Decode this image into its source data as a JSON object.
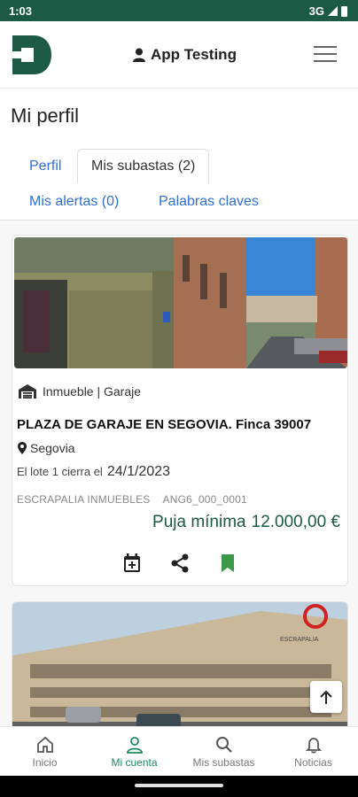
{
  "status_bar": {
    "time": "1:03",
    "network": "3G"
  },
  "header": {
    "user_label": "App Testing"
  },
  "page": {
    "title": "Mi perfil"
  },
  "tabs": [
    {
      "label": "Perfil"
    },
    {
      "label": "Mis subastas (2)"
    },
    {
      "label": "Mis alertas (0)"
    },
    {
      "label": "Palabras claves"
    }
  ],
  "listing": {
    "category": "Inmueble | Garaje",
    "title": "PLAZA DE GARAJE EN SEGOVIA. Finca 39007",
    "location": "Segovia",
    "close_prefix": "El lote 1  cierra el",
    "close_date": "24/1/2023",
    "seller": "ESCRAPALIA INMUEBLES",
    "reference": "ANG6_000_0001",
    "price_label": "Puja mínima",
    "price_value": "12.000,00 €"
  },
  "listing2": {
    "watermark": "ESCRAPALIA"
  },
  "bottom_nav": [
    {
      "label": "Inicio"
    },
    {
      "label": "Mi cuenta"
    },
    {
      "label": "Mis subastas"
    },
    {
      "label": "Noticias"
    }
  ],
  "colors": {
    "brand": "#1c5a46",
    "link": "#2f6fd6",
    "active_nav": "#1c8a5a",
    "bookmark": "#3a9a4a"
  }
}
